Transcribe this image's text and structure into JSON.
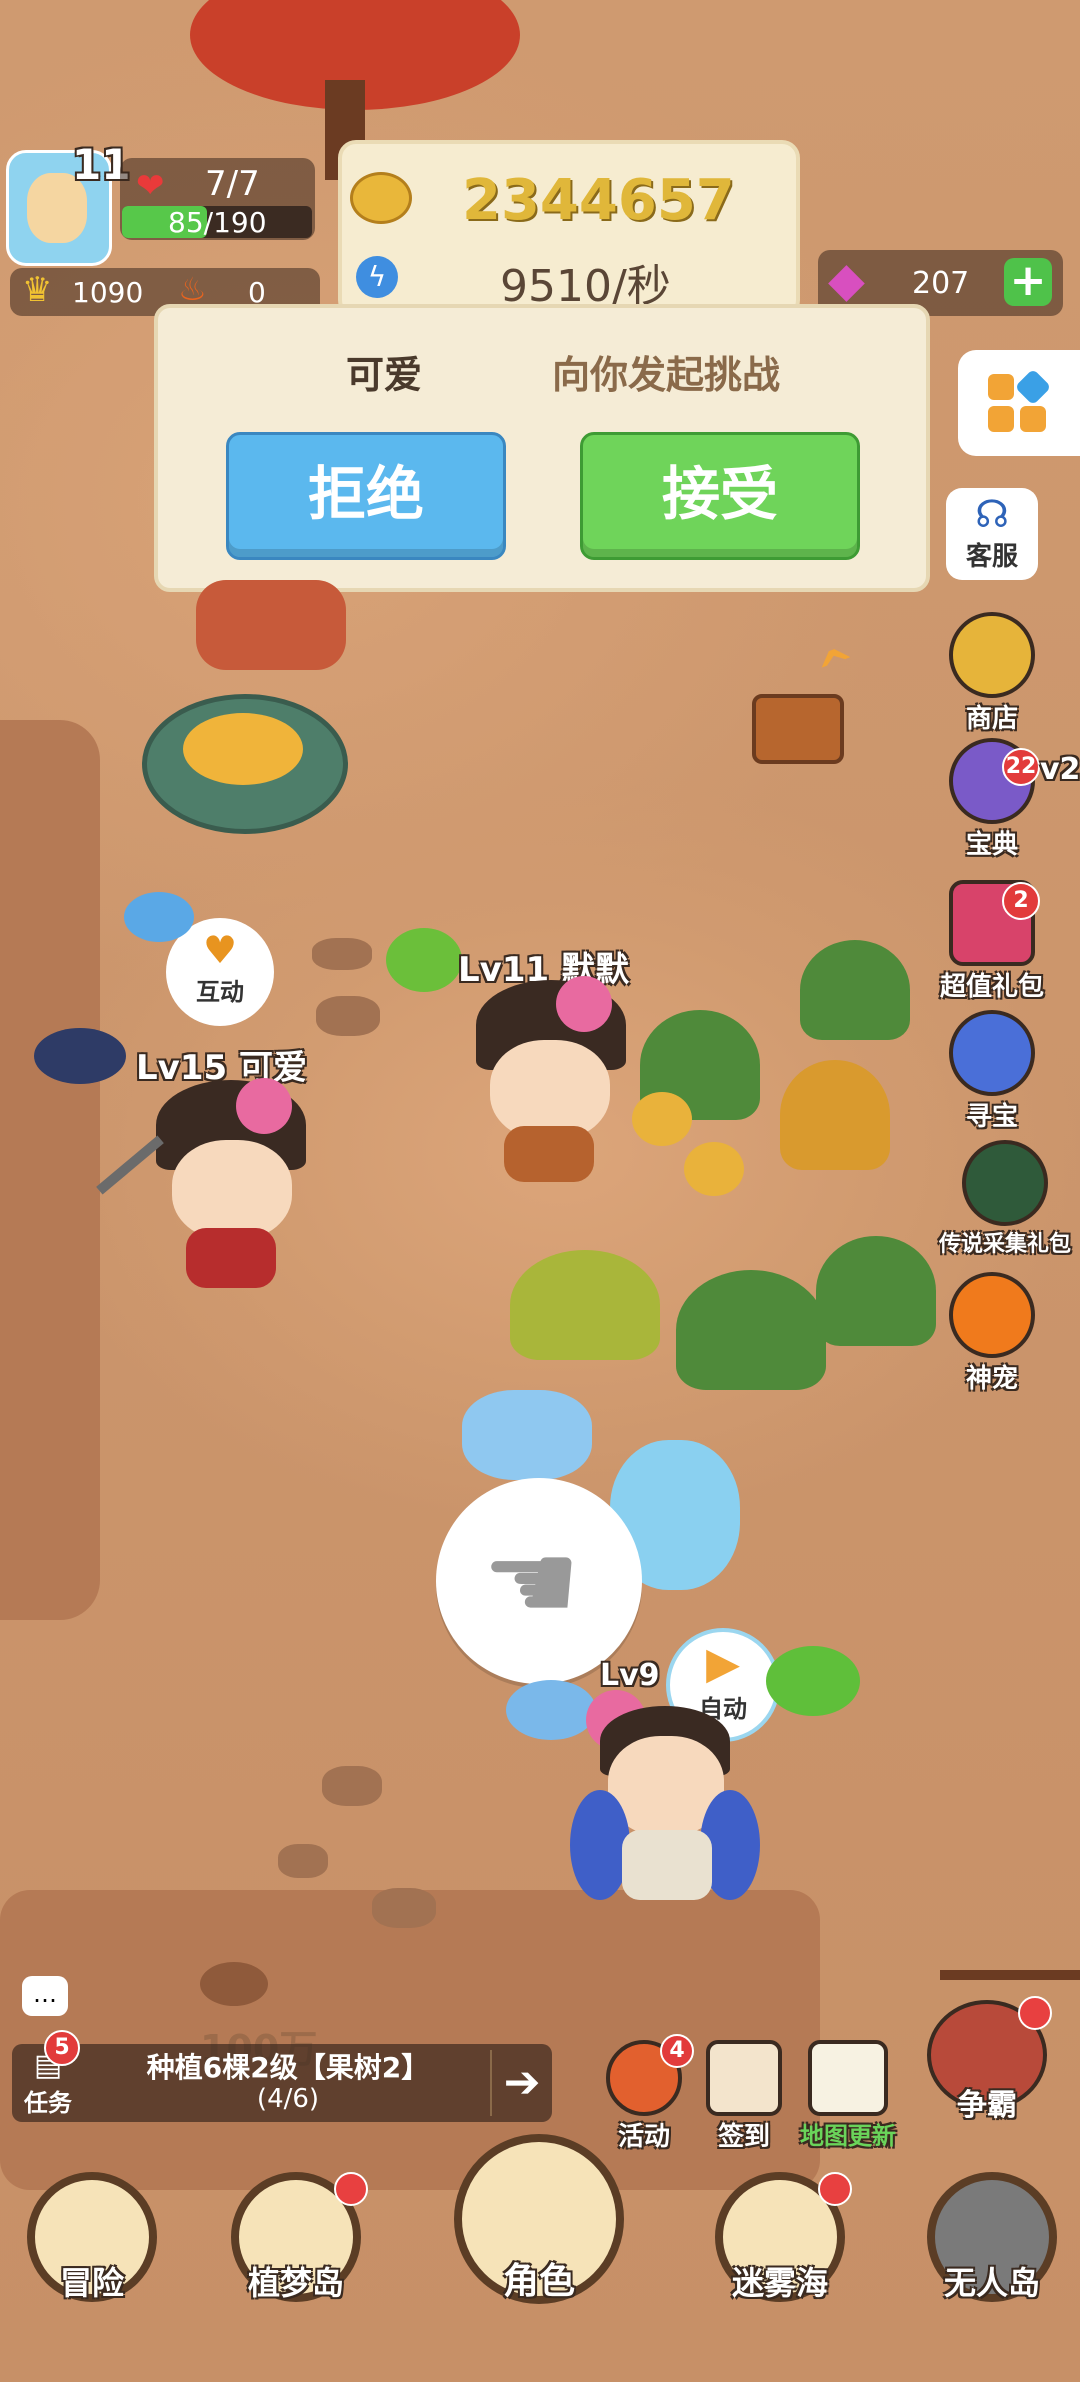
{
  "player": {
    "level": "11",
    "hp": "7/7",
    "exp": "85/190",
    "exp_fraction": 0.447,
    "crown_score": "1090",
    "fire_score": "0"
  },
  "currency": {
    "gold": "2344657",
    "rate": "9510/秒",
    "gems": "207"
  },
  "challenge": {
    "challenger": "可爱",
    "message": "向你发起挑战",
    "reject_label": "拒绝",
    "accept_label": "接受"
  },
  "side_menu": {
    "service": "客服",
    "shop": "商店",
    "codex": "宝典",
    "codex_badge": "22",
    "gift": "超值礼包",
    "gift_badge": "2",
    "treasure": "寻宝",
    "legend_pack": "传说采集礼包",
    "pet": "神宠",
    "partial_lv": "v2"
  },
  "world": {
    "interact_label": "互动",
    "player1_name": "Lv15 可爱",
    "player2_name": "Lv11 默默",
    "self_level": "Lv9",
    "auto_label": "自动",
    "ground_text": "100万"
  },
  "task": {
    "label": "任务",
    "badge": "5",
    "title": "种植6棵2级【果树2】",
    "progress": "(4/6)"
  },
  "shortcuts": {
    "activity": "活动",
    "activity_badge": "4",
    "checkin": "签到",
    "map_update": "地图更新",
    "compete": "争霸"
  },
  "bottom_nav": {
    "adventure": "冒险",
    "dream_island": "植梦岛",
    "character": "角色",
    "mist_sea": "迷雾海",
    "desert_island": "无人岛"
  },
  "colors": {
    "reject": "#5bb8ee",
    "accept": "#6fd45a",
    "gold_text": "#e0b73a",
    "exp_bar": "#57c84a"
  }
}
